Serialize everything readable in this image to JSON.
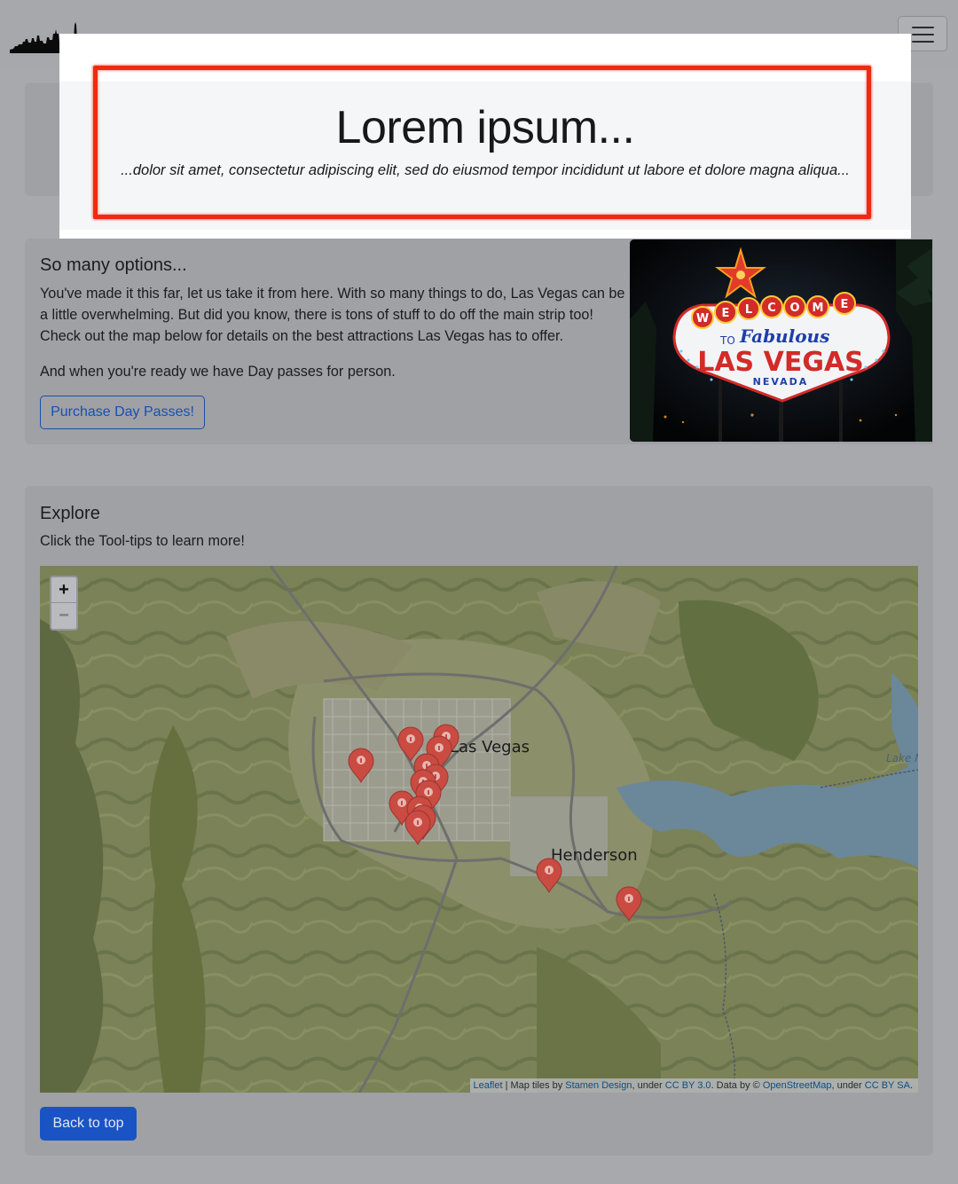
{
  "navbar": {
    "brand_icon": "las-vegas-skyline-icon",
    "toggler_icon": "hamburger-menu-icon"
  },
  "intro": {
    "title": "Lorem ipsum...",
    "subtitle": "...dolor sit amet, consectetur adipiscing elit, sed do eiusmod tempor incididunt ut labore et dolore magna aliqua...",
    "highlight_color": "#ef2a12"
  },
  "options": {
    "heading": "So many options...",
    "paragraph1": "You've made it this far, let us take it from here. With so many things to do, Las Vegas can be a little overwhelming. But did you know, there is tons of stuff to do off the main strip too! Check out the map below for details on the best attractions Las Vegas has to offer.",
    "paragraph2": "And when you're ready we have Day passes for person.",
    "button_label": "Purchase Day Passes!",
    "sign": {
      "welcome": "WELCOME",
      "to": "TO",
      "fabulous": "Fabulous",
      "city": "LAS VEGAS",
      "state": "NEVADA"
    }
  },
  "explore": {
    "heading": "Explore",
    "hint": "Click the Tool-tips to learn more!",
    "map": {
      "zoom_in": "+",
      "zoom_out": "−",
      "labels": {
        "las_vegas": "Las Vegas",
        "henderson": "Henderson",
        "lake": "Lake M"
      },
      "attribution": {
        "leaflet": "Leaflet",
        "sep1": " | Map tiles by ",
        "stamen": "Stamen Design",
        "sep2": ", under ",
        "ccby": "CC BY 3.0",
        "sep3": ". Data by © ",
        "osm": "OpenStreetMap",
        "sep4": ", under ",
        "ccbysa": "CC BY SA",
        "end": "."
      },
      "marker_icon": "map-pin-info-icon",
      "marker_color": "#c94b42",
      "marker_count": 14
    },
    "back_button": "Back to top"
  }
}
